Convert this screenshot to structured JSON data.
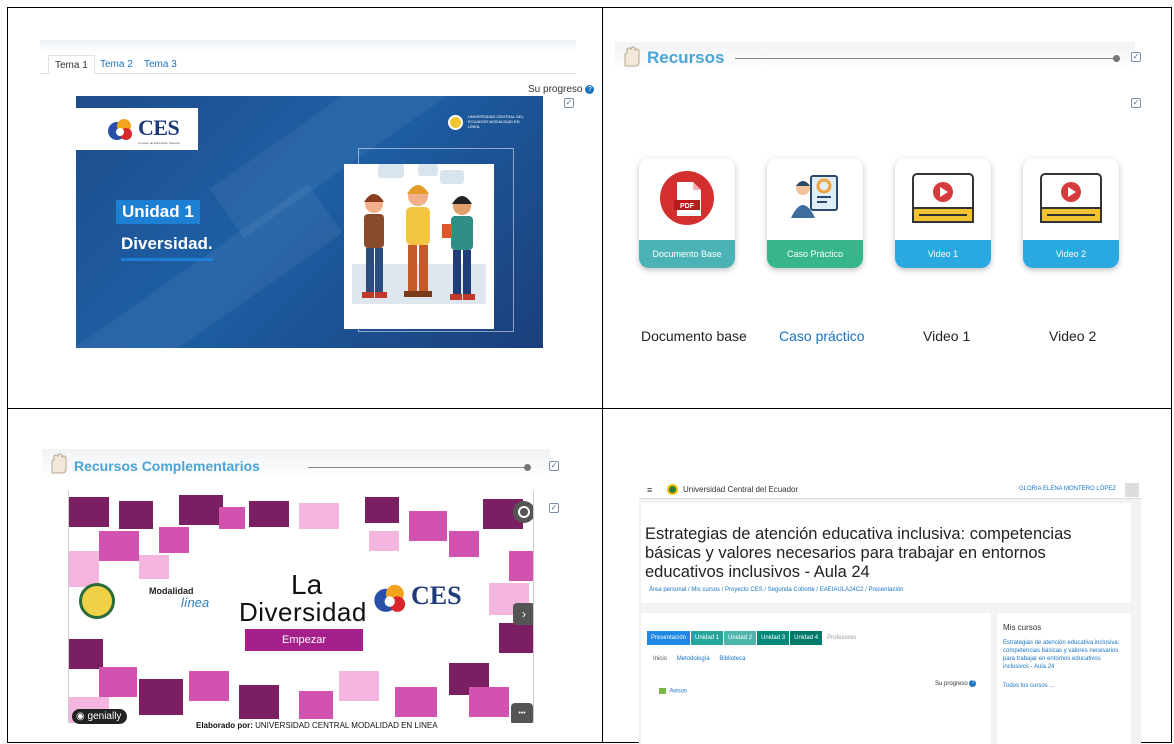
{
  "panel1": {
    "tabs": [
      "Tema 1",
      "Tema 2",
      "Tema 3"
    ],
    "progress_label": "Su progreso",
    "help_glyph": "?",
    "check_glyph": "✓",
    "ces_text": "CES",
    "ces_subtitle": "Consejo de Educación Superior",
    "ucentral_text": "UNIVERSIDAD CENTRAL DEL ECUADOR MODALIDAD EN LÍNEA",
    "unit_label": "Unidad 1",
    "unit_title": "Diversidad."
  },
  "panel2": {
    "section_title": "Recursos",
    "cards": [
      {
        "caption": "Documento Base",
        "icon": "pdf-icon",
        "color": "#4bb3b5"
      },
      {
        "caption": "Caso Práctico",
        "icon": "presenter-icon",
        "color": "#37b58c"
      },
      {
        "caption": "Video 1",
        "icon": "video-player-icon",
        "color": "#2aa9e0"
      },
      {
        "caption": "Video 2",
        "icon": "video-player-icon",
        "color": "#2aa9e0"
      }
    ],
    "pdf_label": "PDF",
    "links": [
      "Documento base",
      "Caso práctico",
      "Video 1",
      "Video 2"
    ]
  },
  "panel3": {
    "section_title": "Recursos Complementarios",
    "title_line1": "La",
    "title_line2": "Diversidad",
    "start_label": "Empezar",
    "modalidad_label": "Modalidad",
    "linea_label": "línea",
    "ces_text": "CES",
    "genially_label": "genially",
    "credit_prefix": "Elaborado por:",
    "credit_text": "UNIVERSIDAD CENTRAL MODALIDAD EN LINEA",
    "next_glyph": "›",
    "more_glyph": "•••",
    "accent_color": "#a6208c"
  },
  "panel4": {
    "site_name": "Universidad Central del Ecuador",
    "user_name": "GLORIA ELENA MONTERO LÓPEZ",
    "course_title": "Estrategias de atención educativa inclusiva: competencias básicas y valores necesarios para trabajar en entornos educativos inclusivos - Aula 24",
    "breadcrumb": "Área personal / Mis cursos / Proyecto CES / Segunda Cohorte / EAEIAULA24C2 / Presentación",
    "tabs": [
      "Presentación",
      "Unidad 1",
      "Unidad 2",
      "Unidad 3",
      "Unidad 4",
      "Profesores"
    ],
    "subtabs": [
      "Inicio",
      "Metodología",
      "Biblioteca"
    ],
    "progress_label": "Su progreso",
    "avisos_label": "Avisos",
    "side_header": "Mis cursos",
    "side_course": "Estrategias de atención educativa inclusiva: competencias básicas y valores necesarios para trabajar en entornos educativos inclusivos - Aula 24",
    "side_all": "Todos los cursos ...",
    "hamburger": "≡",
    "caret": "▾"
  }
}
